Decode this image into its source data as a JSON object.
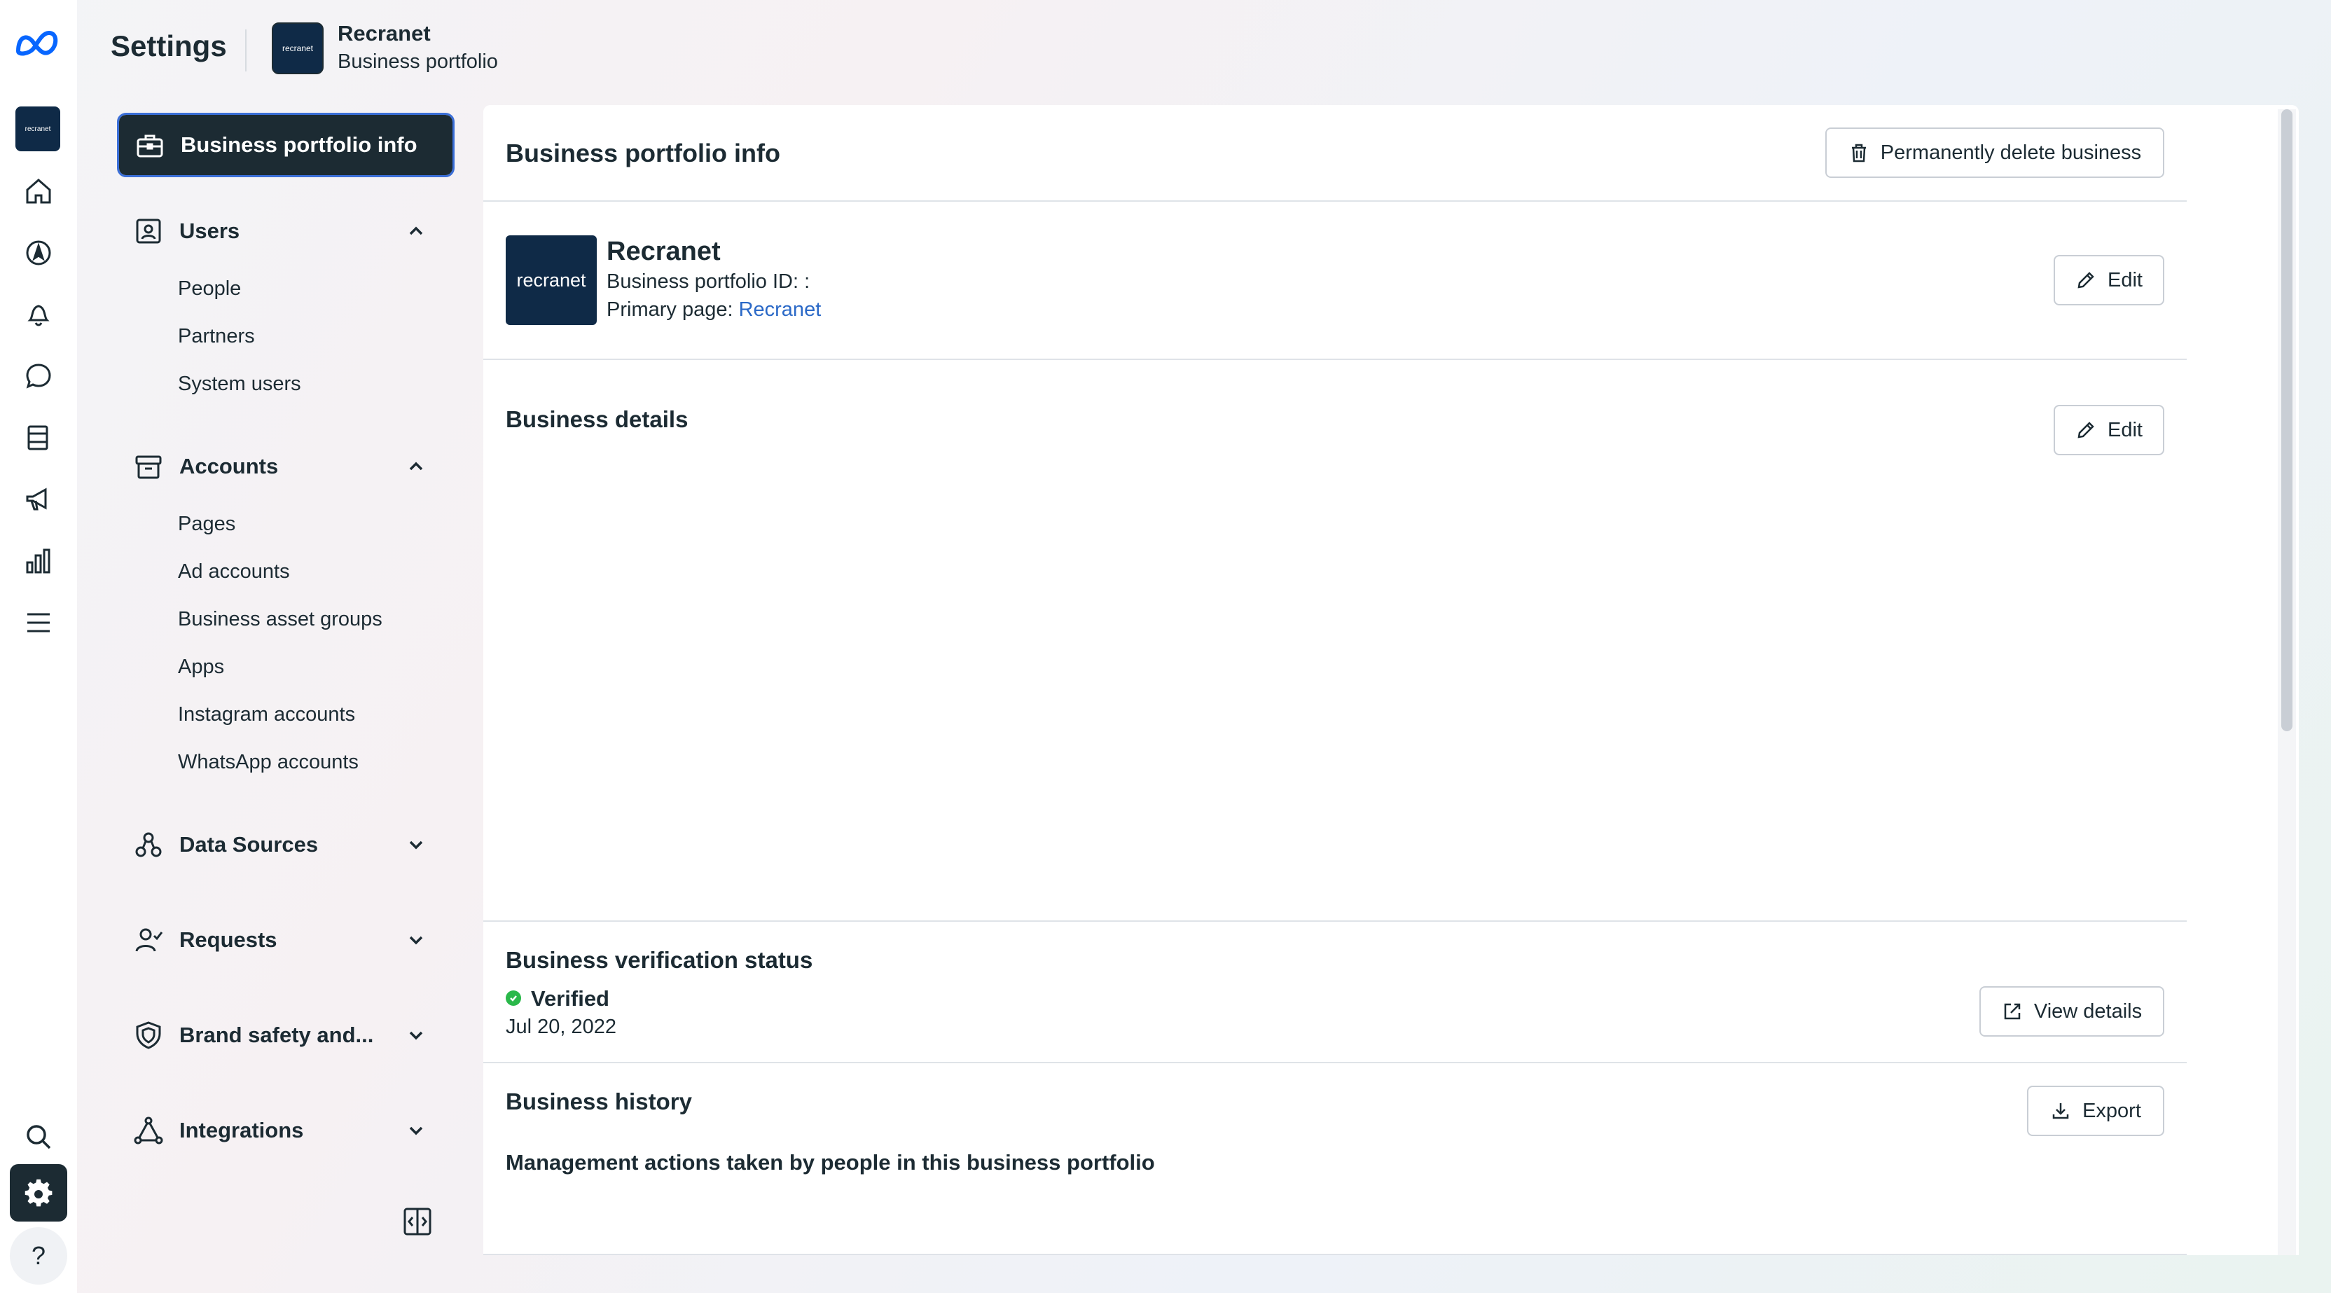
{
  "rail": {
    "avatar_text": "recranet",
    "icons": [
      "meta-logo-icon",
      "home-icon",
      "compass-icon",
      "bell-icon",
      "chat-icon",
      "pages-icon",
      "megaphone-icon",
      "insights-icon",
      "menu-icon",
      "search-icon",
      "gear-icon",
      "help-icon"
    ],
    "help_glyph": "?"
  },
  "header": {
    "title": "Settings",
    "avatar_text": "recranet",
    "business_name": "Recranet",
    "business_sub": "Business portfolio"
  },
  "sidebar": {
    "active": "Business portfolio info",
    "sections": [
      {
        "label": "Users",
        "expanded": true,
        "items": [
          "People",
          "Partners",
          "System users"
        ]
      },
      {
        "label": "Accounts",
        "expanded": true,
        "items": [
          "Pages",
          "Ad accounts",
          "Business asset groups",
          "Apps",
          "Instagram accounts",
          "WhatsApp accounts"
        ]
      },
      {
        "label": "Data Sources",
        "expanded": false
      },
      {
        "label": "Requests",
        "expanded": false
      },
      {
        "label": "Brand safety and...",
        "expanded": false
      },
      {
        "label": "Integrations",
        "expanded": false
      }
    ]
  },
  "main": {
    "title": "Business portfolio info",
    "delete_button": "Permanently delete business",
    "business": {
      "logo_text": "recranet",
      "name": "Recranet",
      "id_label": "Business portfolio ID: :",
      "primary_page_label": "Primary page: ",
      "primary_page_link": "Recranet",
      "edit_label": "Edit"
    },
    "details": {
      "title": "Business details",
      "edit_label": "Edit"
    },
    "verification": {
      "title": "Business verification status",
      "status": "Verified",
      "date": "Jul 20, 2022",
      "view_details_label": "View details"
    },
    "history": {
      "title": "Business history",
      "export_label": "Export",
      "description": "Management actions taken by people in this business portfolio"
    }
  },
  "colors": {
    "dark": "#1c2b33",
    "brand_navy": "#0f2a47",
    "link": "#2b69c7",
    "verified": "#2ab84a",
    "focus_ring": "#3b6fd8"
  }
}
